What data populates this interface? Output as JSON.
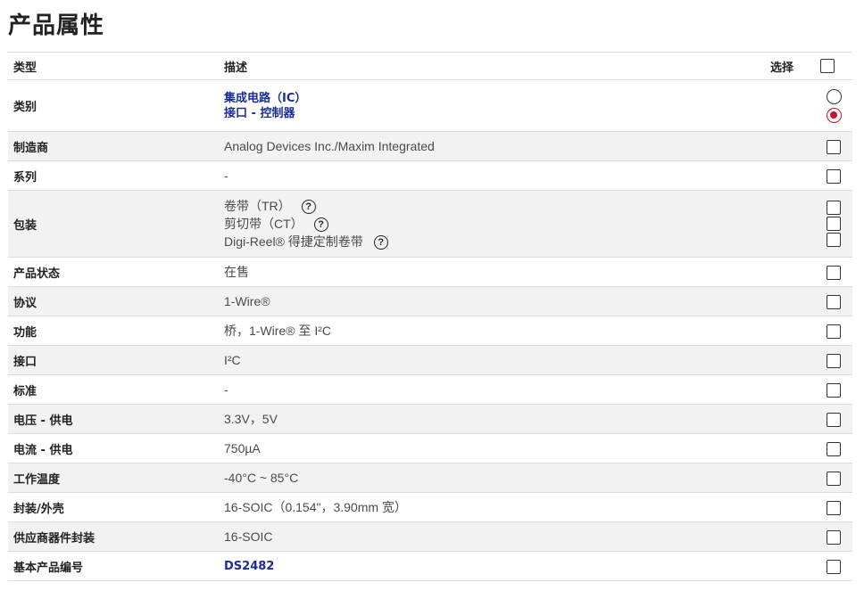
{
  "page_title": "产品属性",
  "header": {
    "type": "类型",
    "description": "描述",
    "select": "选择"
  },
  "category": {
    "type": "类别",
    "links": [
      "集成电路（IC）",
      "接口 - 控制器"
    ]
  },
  "manufacturer": {
    "type": "制造商",
    "value": "Analog Devices Inc./Maxim Integrated"
  },
  "series": {
    "type": "系列",
    "value": "-"
  },
  "packaging": {
    "type": "包装",
    "options": [
      "卷带（TR）",
      "剪切带（CT）",
      "Digi-Reel® 得捷定制卷带"
    ],
    "help_icon": "?"
  },
  "status": {
    "type": "产品状态",
    "value": "在售"
  },
  "protocol": {
    "type": "协议",
    "value": "1-Wire®"
  },
  "function": {
    "type": "功能",
    "value": "桥，1-Wire® 至 I²C"
  },
  "interface": {
    "type": "接口",
    "value": "I²C"
  },
  "standard": {
    "type": "标准",
    "value": "-"
  },
  "voltage": {
    "type": "电压 - 供电",
    "value": "3.3V，5V"
  },
  "current": {
    "type": "电流 - 供电",
    "value": "750µA"
  },
  "temperature": {
    "type": "工作温度",
    "value": "-40°C ~ 85°C"
  },
  "case": {
    "type": "封装/外壳",
    "value": "16-SOIC（0.154\"，3.90mm 宽）"
  },
  "supplier_package": {
    "type": "供应商器件封装",
    "value": "16-SOIC"
  },
  "base_part": {
    "type": "基本产品编号",
    "value": "DS2482"
  },
  "colors": {
    "link": "#1b2d98",
    "radio_selected": "#c8102e",
    "row_alt": "#f2f2f2"
  }
}
